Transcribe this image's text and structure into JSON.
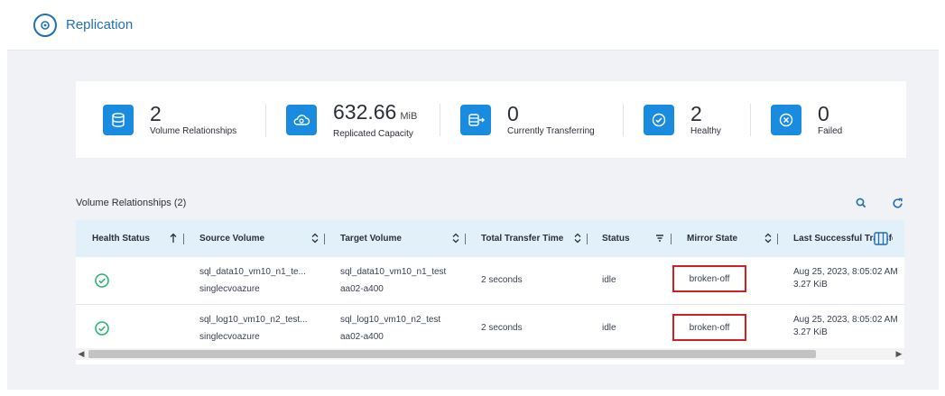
{
  "header": {
    "title": "Replication",
    "icon": "replication-icon"
  },
  "summary": [
    {
      "id": "relationships",
      "value": "2",
      "unit": "",
      "label": "Volume Relationships",
      "icon": "database-icon"
    },
    {
      "id": "capacity",
      "value": "632.66",
      "unit": "MiB",
      "label": "Replicated Capacity",
      "icon": "cloud-icon"
    },
    {
      "id": "transferring",
      "value": "0",
      "unit": "",
      "label": "Currently Transferring",
      "icon": "transfer-icon"
    },
    {
      "id": "healthy",
      "value": "2",
      "unit": "",
      "label": "Healthy",
      "icon": "check-circle-icon"
    },
    {
      "id": "failed",
      "value": "0",
      "unit": "",
      "label": "Failed",
      "icon": "x-circle-icon"
    }
  ],
  "table": {
    "title": "Volume Relationships (2)",
    "columns": [
      "Health Status",
      "Source Volume",
      "Target Volume",
      "Total Transfer Time",
      "Status",
      "Mirror State",
      "Last Successful Transfer"
    ],
    "rows": [
      {
        "health": "healthy",
        "source_volume": "sql_data10_vm10_n1_te...",
        "source_sub": "singlecvoazure",
        "target_volume": "sql_data10_vm10_n1_test",
        "target_sub": "aa02-a400",
        "transfer_time": "2 seconds",
        "status": "idle",
        "mirror_state": "broken-off",
        "last_transfer": "Aug 25, 2023, 8:05:02 AM",
        "last_size": "3.27 KiB"
      },
      {
        "health": "healthy",
        "source_volume": "sql_log10_vm10_n2_test...",
        "source_sub": "singlecvoazure",
        "target_volume": "sql_log10_vm10_n2_test",
        "target_sub": "aa02-a400",
        "transfer_time": "2 seconds",
        "status": "idle",
        "mirror_state": "broken-off",
        "last_transfer": "Aug 25, 2023, 8:05:02 AM",
        "last_size": "3.27 KiB"
      }
    ]
  },
  "colors": {
    "accent": "#1a8ce0",
    "header_bg": "#e2f0fa",
    "healthy": "#2bb573",
    "highlight": "#d11f26"
  }
}
